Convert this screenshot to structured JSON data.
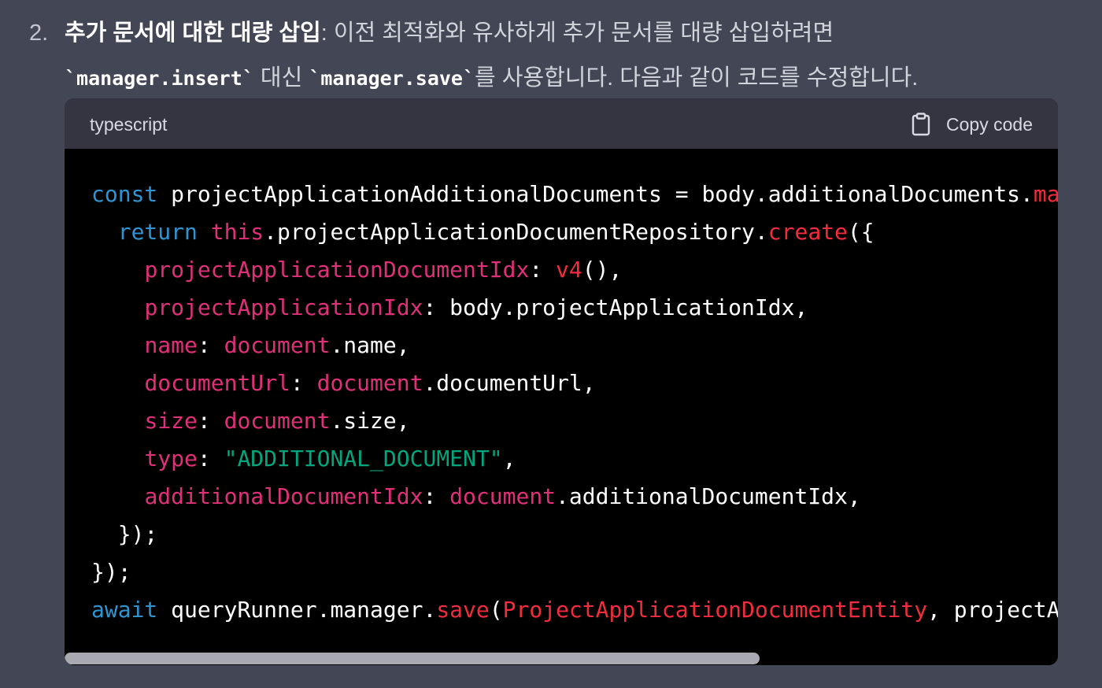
{
  "list": {
    "number": "2.",
    "heading": "추가 문서에 대한 대량 삽입",
    "line1_rest": ": 이전 최적화와 유사하게 추가 문서를 대량 삽입하려면",
    "code_insert": "`manager.insert`",
    "text_instead": " 대신 ",
    "code_save": "`manager.save`",
    "line2_rest": "를 사용합니다. 다음과 같이 코드를 수정합니다."
  },
  "code_block": {
    "language": "typescript",
    "copy_label": "Copy code",
    "copy_icon": "clipboard-icon",
    "lines": [
      [
        {
          "t": "const",
          "c": "kw"
        },
        {
          "t": " projectApplicationAdditionalDocuments = body.additionalDocuments.",
          "c": ""
        },
        {
          "t": "ma",
          "c": "fn"
        }
      ],
      [
        {
          "t": "  ",
          "c": ""
        },
        {
          "t": "return",
          "c": "kw"
        },
        {
          "t": " ",
          "c": ""
        },
        {
          "t": "this",
          "c": "red"
        },
        {
          "t": ".projectApplicationDocumentRepository.",
          "c": ""
        },
        {
          "t": "create",
          "c": "fn"
        },
        {
          "t": "({",
          "c": ""
        }
      ],
      [
        {
          "t": "    ",
          "c": ""
        },
        {
          "t": "projectApplicationDocumentIdx",
          "c": "red"
        },
        {
          "t": ": ",
          "c": ""
        },
        {
          "t": "v4",
          "c": "fn"
        },
        {
          "t": "(),",
          "c": ""
        }
      ],
      [
        {
          "t": "    ",
          "c": ""
        },
        {
          "t": "projectApplicationIdx",
          "c": "red"
        },
        {
          "t": ": body.projectApplicationIdx,",
          "c": ""
        }
      ],
      [
        {
          "t": "    ",
          "c": ""
        },
        {
          "t": "name",
          "c": "red"
        },
        {
          "t": ": ",
          "c": ""
        },
        {
          "t": "document",
          "c": "red"
        },
        {
          "t": ".name,",
          "c": ""
        }
      ],
      [
        {
          "t": "    ",
          "c": ""
        },
        {
          "t": "documentUrl",
          "c": "red"
        },
        {
          "t": ": ",
          "c": ""
        },
        {
          "t": "document",
          "c": "red"
        },
        {
          "t": ".documentUrl,",
          "c": ""
        }
      ],
      [
        {
          "t": "    ",
          "c": ""
        },
        {
          "t": "size",
          "c": "red"
        },
        {
          "t": ": ",
          "c": ""
        },
        {
          "t": "document",
          "c": "red"
        },
        {
          "t": ".size,",
          "c": ""
        }
      ],
      [
        {
          "t": "    ",
          "c": ""
        },
        {
          "t": "type",
          "c": "red"
        },
        {
          "t": ": ",
          "c": ""
        },
        {
          "t": "\"ADDITIONAL_DOCUMENT\"",
          "c": "str"
        },
        {
          "t": ",",
          "c": ""
        }
      ],
      [
        {
          "t": "    ",
          "c": ""
        },
        {
          "t": "additionalDocumentIdx",
          "c": "red"
        },
        {
          "t": ": ",
          "c": ""
        },
        {
          "t": "document",
          "c": "red"
        },
        {
          "t": ".additionalDocumentIdx,",
          "c": ""
        }
      ],
      [
        {
          "t": "  });",
          "c": ""
        }
      ],
      [
        {
          "t": "});",
          "c": ""
        }
      ],
      [
        {
          "t": "await",
          "c": "kw"
        },
        {
          "t": " queryRunner.manager.",
          "c": ""
        },
        {
          "t": "save",
          "c": "fn"
        },
        {
          "t": "(",
          "c": ""
        },
        {
          "t": "ProjectApplicationDocumentEntity",
          "c": "fn"
        },
        {
          "t": ", projectAp",
          "c": ""
        }
      ]
    ],
    "scroll_position": 0.0,
    "scroll_visible_fraction": 0.7
  },
  "colors": {
    "background": "#434654",
    "code_header": "#343541",
    "code_background": "#000000",
    "keyword": "#2e95d3",
    "identifier_red": "#df3079",
    "string": "#00a67d",
    "function": "#f22c3d"
  }
}
